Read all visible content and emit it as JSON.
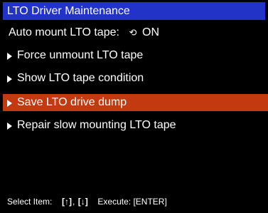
{
  "title": "LTO Driver Maintenance",
  "menu": {
    "auto_mount": {
      "label": "Auto mount LTO tape:",
      "icon": "cycle-icon",
      "value": "ON"
    },
    "items": [
      {
        "label": "Force unmount LTO tape",
        "selected": false
      },
      {
        "label": "Show LTO tape condition",
        "selected": false
      },
      {
        "label": "Save LTO drive dump",
        "selected": true
      },
      {
        "label": "Repair slow mounting LTO tape",
        "selected": false
      }
    ]
  },
  "footer": {
    "select_label": "Select Item:",
    "key_up": "[↑]",
    "key_sep": ",",
    "key_down": "[↓]",
    "execute_label": "Execute: [ENTER]"
  },
  "colors": {
    "title_bg": "#2233c8",
    "selected_bg": "#c43a10",
    "background": "#000000",
    "text": "#ffffff"
  }
}
